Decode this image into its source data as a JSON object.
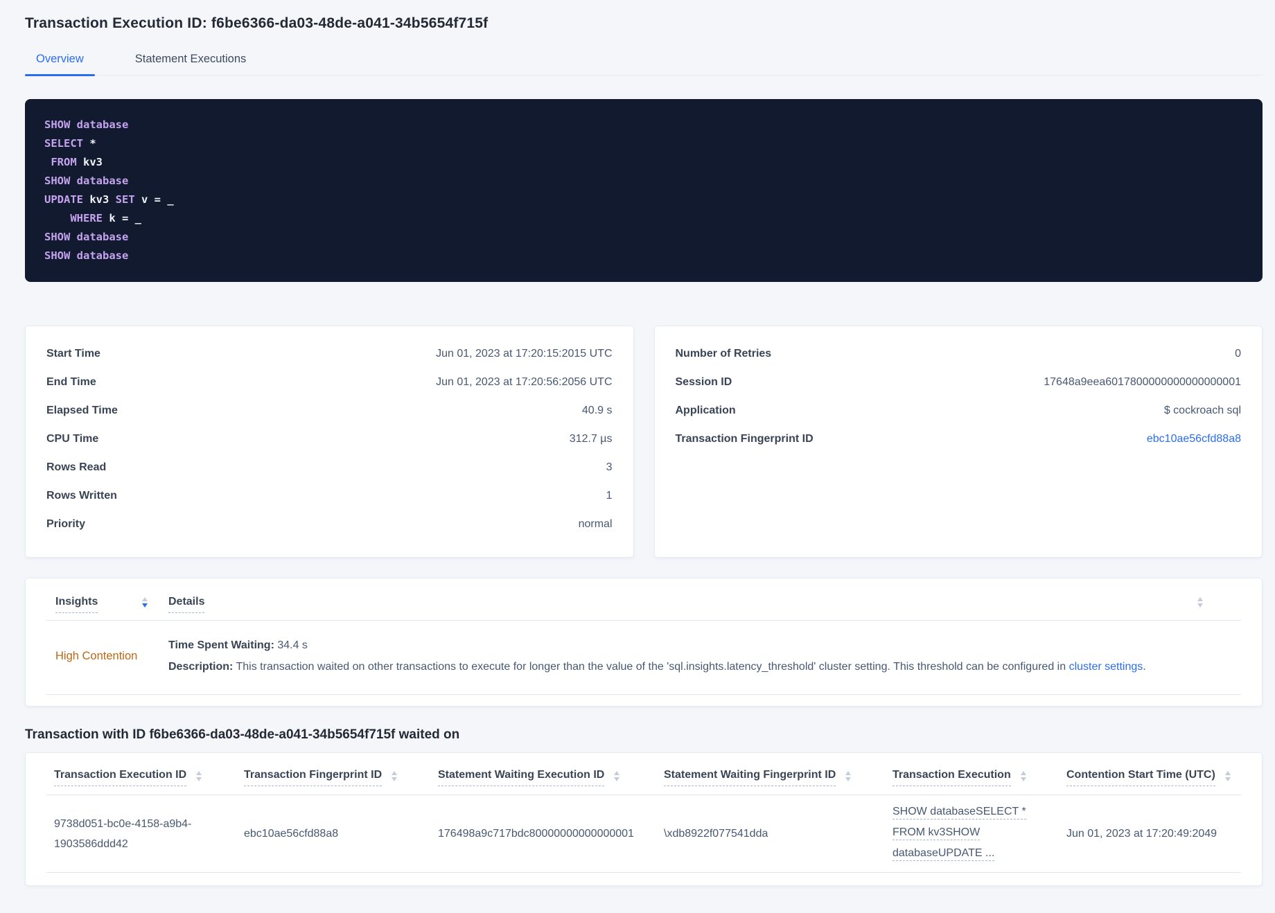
{
  "page_title": "Transaction Execution ID: f6be6366-da03-48de-a041-34b5654f715f",
  "tabs": [
    {
      "label": "Overview",
      "active": true
    },
    {
      "label": "Statement Executions",
      "active": false
    }
  ],
  "sql_box": {
    "lines": [
      {
        "segments": [
          {
            "text": "SHOW database",
            "kw": true
          }
        ]
      },
      {
        "segments": [
          {
            "text": "SELECT",
            "kw": true
          },
          {
            "text": " *",
            "kw": false
          }
        ]
      },
      {
        "segments": [
          {
            "text": " ",
            "kw": false
          },
          {
            "text": "FROM",
            "kw": true
          },
          {
            "text": " kv3",
            "kw": false
          }
        ]
      },
      {
        "segments": [
          {
            "text": "SHOW database",
            "kw": true
          }
        ]
      },
      {
        "segments": [
          {
            "text": "UPDATE",
            "kw": true
          },
          {
            "text": " kv3 ",
            "kw": false
          },
          {
            "text": "SET",
            "kw": true
          },
          {
            "text": " v = _",
            "kw": false
          }
        ]
      },
      {
        "segments": [
          {
            "text": "    ",
            "kw": false
          },
          {
            "text": "WHERE",
            "kw": true
          },
          {
            "text": " k = _",
            "kw": false
          }
        ]
      },
      {
        "segments": [
          {
            "text": "SHOW database",
            "kw": true
          }
        ]
      },
      {
        "segments": [
          {
            "text": "SHOW database",
            "kw": true
          }
        ]
      }
    ]
  },
  "summary_cards": {
    "left": {
      "rows": [
        {
          "label": "Start Time",
          "value": "Jun 01, 2023 at 17:20:15:2015 UTC"
        },
        {
          "label": "End Time",
          "value": "Jun 01, 2023 at 17:20:56:2056 UTC"
        },
        {
          "label": "Elapsed Time",
          "value": "40.9 s"
        },
        {
          "label": "CPU Time",
          "value": "312.7 µs"
        },
        {
          "label": "Rows Read",
          "value": "3"
        },
        {
          "label": "Rows Written",
          "value": "1"
        },
        {
          "label": "Priority",
          "value": "normal"
        }
      ]
    },
    "right": {
      "rows": [
        {
          "label": "Number of Retries",
          "value": "0"
        },
        {
          "label": "Session ID",
          "value": "17648a9eea6017800000000000000001"
        },
        {
          "label": "Application",
          "value": "$ cockroach sql"
        },
        {
          "label": "Transaction Fingerprint ID",
          "value": "ebc10ae56cfd88a8",
          "link": true
        }
      ]
    }
  },
  "insights_table": {
    "columns": [
      {
        "label": "Insights",
        "sorted": "desc"
      },
      {
        "label": "Details",
        "sorted": null
      }
    ],
    "row": {
      "insight": "High Contention",
      "waiting_label": "Time Spent Waiting:",
      "waiting_value": " 34.4 s",
      "description_label": "Description:",
      "description_text": " This transaction waited on other transactions to execute for longer than the value of the 'sql.insights.latency_threshold' cluster setting. This threshold can be configured in ",
      "description_link": "cluster settings",
      "description_suffix": "."
    }
  },
  "waited_on": {
    "heading": "Transaction with ID f6be6366-da03-48de-a041-34b5654f715f waited on",
    "columns": [
      "Transaction Execution ID",
      "Transaction Fingerprint ID",
      "Statement Waiting Execution ID",
      "Statement Waiting Fingerprint ID",
      "Transaction Execution",
      "Contention Start Time (UTC)"
    ],
    "rows": [
      {
        "transaction_execution_id": "9738d051-bc0e-4158-a9b4-1903586ddd42",
        "transaction_fingerprint_id": "ebc10ae56cfd88a8",
        "statement_waiting_execution_id": "176498a9c717bdc80000000000000001",
        "statement_waiting_fingerprint_id": "\\xdb8922f077541dda",
        "transaction_execution_lines": [
          "SHOW databaseSELECT *",
          "FROM kv3SHOW",
          "databaseUPDATE ..."
        ],
        "contention_start_time": "Jun 01, 2023 at 17:20:49:2049"
      }
    ]
  },
  "colors": {
    "accent_blue": "#2a6df4",
    "warning_orange": "#bf6612",
    "code_background": "#111a2e",
    "code_keyword": "#c5a3ef",
    "page_background": "#f4f6fa"
  }
}
